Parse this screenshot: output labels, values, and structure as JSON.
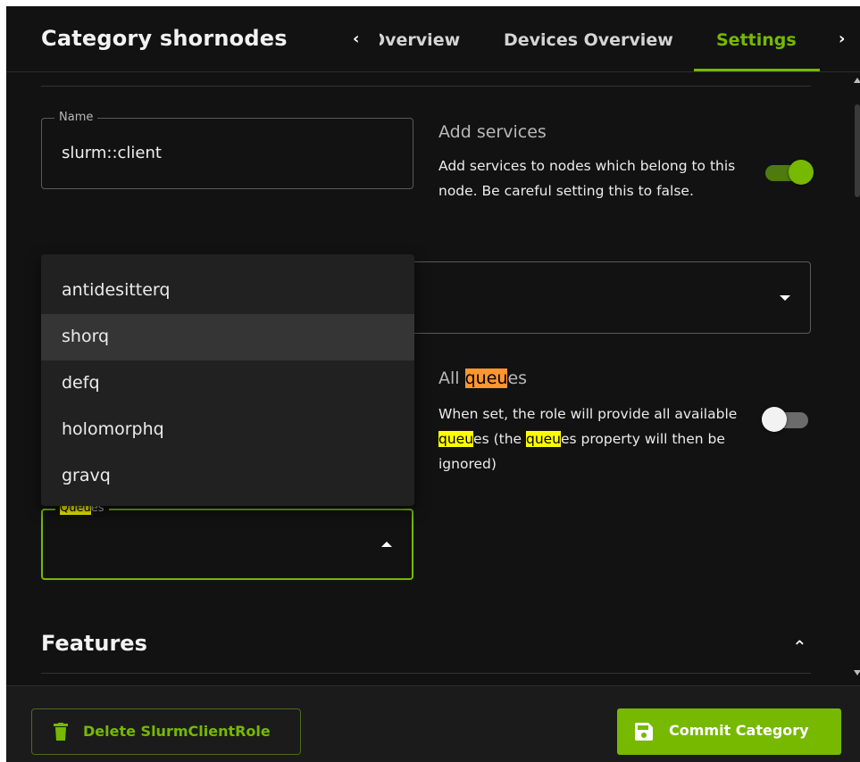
{
  "header": {
    "title": "Category shornodes",
    "tabs": [
      {
        "label": "Overview",
        "visible_label": ")verview"
      },
      {
        "label": "Devices Overview"
      },
      {
        "label": "Settings",
        "active": true
      }
    ]
  },
  "form": {
    "name": {
      "label": "Name",
      "value": "slurm::client"
    },
    "add_services": {
      "heading": "Add services",
      "description": "Add services to nodes which belong to this node. Be careful setting this to false.",
      "enabled": true
    },
    "all_queues": {
      "heading_prefix": "All ",
      "heading_highlight": "queu",
      "heading_suffix": "es",
      "desc_part1": "When set, the role will provide all available ",
      "desc_hl1": "queu",
      "desc_part2": "es (the ",
      "desc_hl2": "queu",
      "desc_part3": "es property will then be ignored)",
      "enabled": false
    },
    "queues": {
      "label_highlight": "Queu",
      "label_rest": "es",
      "options": [
        "antidesitterq",
        "shorq",
        "defq",
        "holomorphq",
        "gravq"
      ],
      "highlighted_option": "shorq"
    }
  },
  "sections": {
    "features": "Features"
  },
  "footer": {
    "delete_label": "Delete SlurmClientRole",
    "commit_label": "Commit Category"
  },
  "colors": {
    "accent": "#76b900",
    "background": "#121212",
    "search_highlight": "#ffff00",
    "current_match": "#ff9632"
  }
}
